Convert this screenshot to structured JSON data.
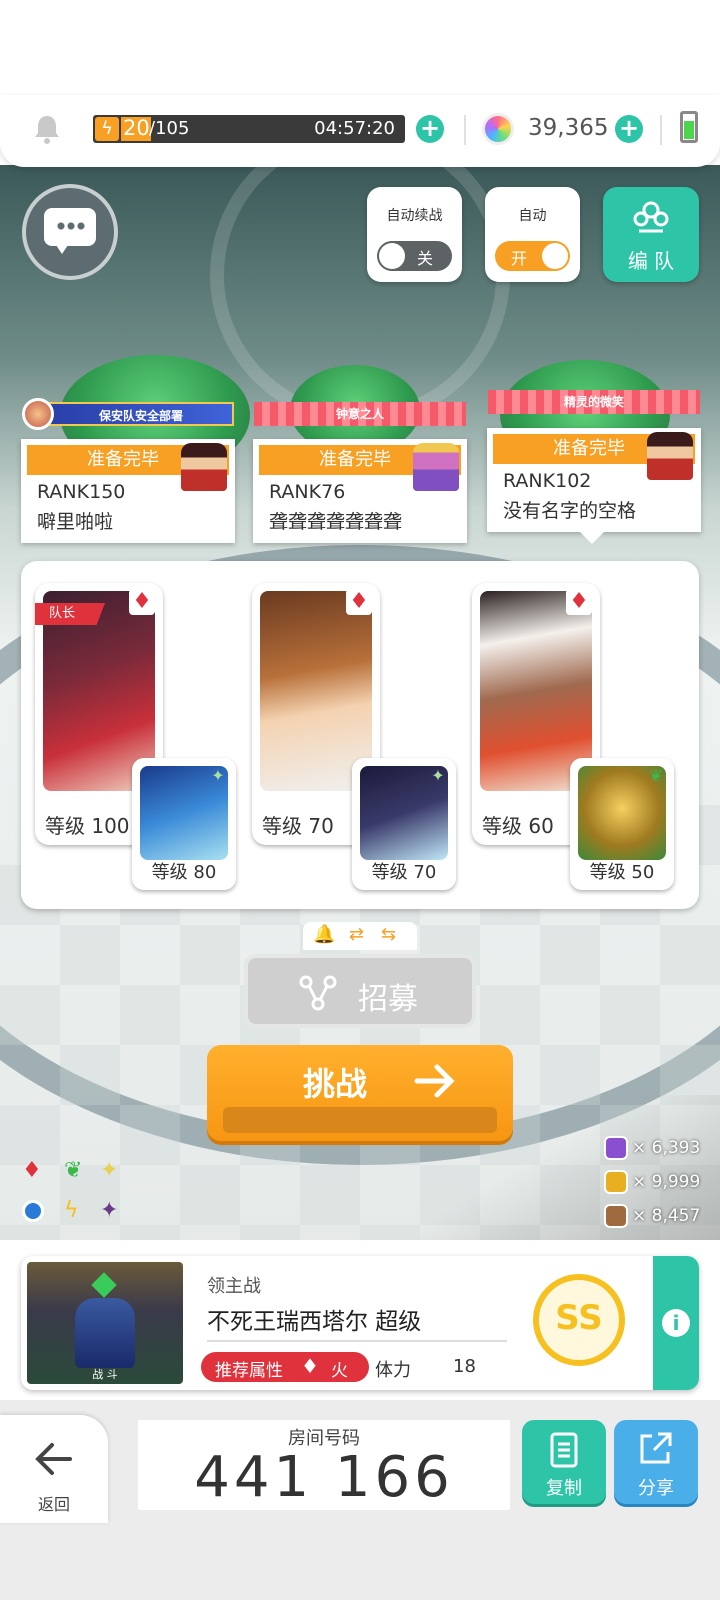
{
  "status_bar": {
    "stamina_current": "20",
    "stamina_max": "/105",
    "timer": "04:57:20",
    "gems": "39,365"
  },
  "controls": {
    "auto_continue_label": "自动续战",
    "auto_continue_state": "关",
    "auto_label": "自动",
    "auto_state": "开",
    "team_button": "编 队"
  },
  "players": [
    {
      "title": "保安队安全部署",
      "ready": "准备完毕",
      "rank": "RANK150",
      "name": "噼里啪啦"
    },
    {
      "title": "钟意之人",
      "ready": "准备完毕",
      "rank": "RANK76",
      "name": "聋聋聋聋聋聋聋"
    },
    {
      "title": "精灵的微笑",
      "ready": "准备完毕",
      "rank": "RANK102",
      "name": "没有名字的空格"
    }
  ],
  "party": [
    {
      "leader_tag": "队长",
      "main_level": "等级 100",
      "sub_level": "等级 80"
    },
    {
      "leader_tag": "",
      "main_level": "等级 70",
      "sub_level": "等级 70"
    },
    {
      "leader_tag": "",
      "main_level": "等级 60",
      "sub_level": "等级 50"
    }
  ],
  "recruit_button": "招募",
  "challenge_button": "挑战",
  "resources": [
    {
      "icon": "purple-emblem-icon",
      "value": "× 6,393",
      "color": "#8a4fd0"
    },
    {
      "icon": "gold-emblem-icon",
      "value": "× 9,999",
      "color": "#e8b020"
    },
    {
      "icon": "bronze-emblem-icon",
      "value": "× 8,457",
      "color": "#a06a40"
    }
  ],
  "boss": {
    "category": "领主战",
    "name": "不死王瑞西塔尔 超级",
    "recommend_label": "推荐属性",
    "element": "火",
    "stamina_label": "体力",
    "stamina_value": "18",
    "portrait_caption": "战 斗",
    "grade": "SS"
  },
  "bottom": {
    "back_label": "返回",
    "room_label": "房间号码",
    "room_number": "441 166",
    "copy_label": "复制",
    "share_label": "分享"
  },
  "colors": {
    "accent_orange": "#f7a024",
    "teal": "#2ec4a8",
    "red": "#e0323c",
    "blue": "#4aaee8"
  }
}
